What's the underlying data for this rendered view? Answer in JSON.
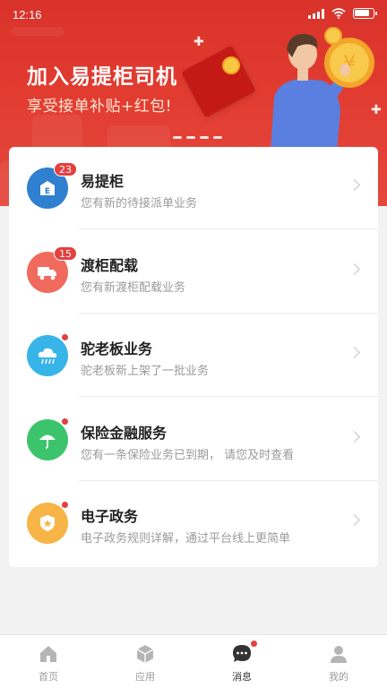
{
  "status_bar": {
    "time": "12:16"
  },
  "banner": {
    "title": "加入易提柜司机",
    "subtitle": "享受接单补贴+红包!"
  },
  "messages": [
    {
      "title": "易提柜",
      "description": "您有新的待接派单业务",
      "badge": "23",
      "icon": "cabinet-icon",
      "color": "#2f80d0"
    },
    {
      "title": "渡柜配载",
      "description": "您有新渡柜配载业务",
      "badge": "15",
      "icon": "truck-icon",
      "color": "#f06a5d"
    },
    {
      "title": "驼老板业务",
      "description": "驼老板新上架了一批业务",
      "badge": "",
      "icon": "cloud-icon",
      "color": "#37b4e8"
    },
    {
      "title": "保险金融服务",
      "description": "您有一条保险业务已到期， 请您及时查看",
      "badge": "",
      "icon": "umbrella-icon",
      "color": "#3cc46c"
    },
    {
      "title": "电子政务",
      "description": "电子政务规则详解，通过平台线上更简单",
      "badge": "",
      "icon": "shield-star-icon",
      "color": "#f7b547"
    }
  ],
  "tabs": [
    {
      "label": "首页",
      "icon": "home-icon"
    },
    {
      "label": "应用",
      "icon": "cube-icon"
    },
    {
      "label": "消息",
      "icon": "chat-icon",
      "active": true
    },
    {
      "label": "我的",
      "icon": "user-icon"
    }
  ],
  "colors": {
    "brand_red": "#e03a30",
    "badge_red": "#e34040"
  }
}
